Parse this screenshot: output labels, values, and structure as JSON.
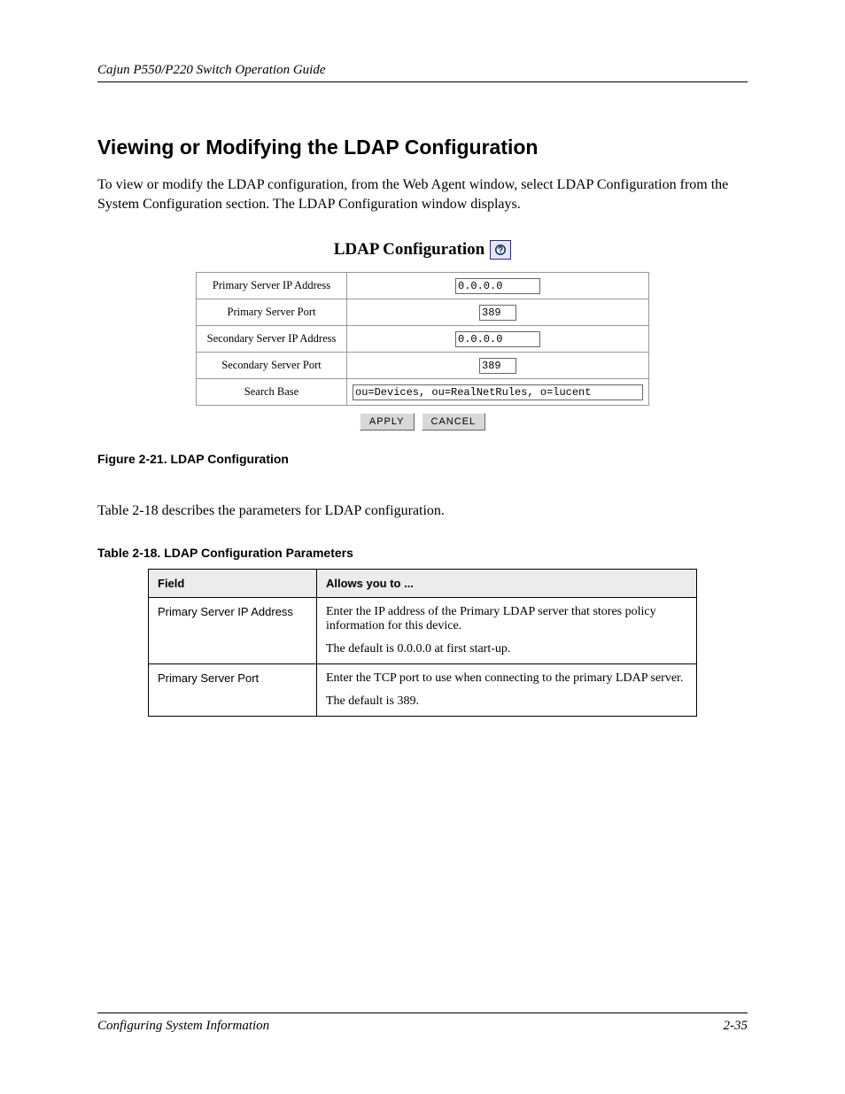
{
  "header": {
    "left": "Cajun P550/P220 Switch Operation Guide",
    "right": ""
  },
  "section_heading": "Viewing or Modifying the LDAP Configuration",
  "intro_text": "To view or modify the LDAP configuration, from the Web Agent window, select LDAP Configuration from the System Configuration section. The LDAP Configuration window displays.",
  "figure": {
    "title": "LDAP Configuration",
    "help_icon_name": "help-icon",
    "rows": [
      {
        "label": "Primary Server IP Address",
        "value": "0.0.0.0",
        "kind": "short"
      },
      {
        "label": "Primary Server Port",
        "value": "389",
        "kind": "tiny"
      },
      {
        "label": "Secondary Server IP Address",
        "value": "0.0.0.0",
        "kind": "short"
      },
      {
        "label": "Secondary Server Port",
        "value": "389",
        "kind": "tiny"
      },
      {
        "label": "Search Base",
        "value": "ou=Devices, ou=RealNetRules, o=lucent",
        "kind": "long"
      }
    ],
    "buttons": {
      "apply": "APPLY",
      "cancel": "CANCEL"
    }
  },
  "figure_caption": "Figure 2-21.  LDAP Configuration",
  "after_figure_text": "Table 2-18 describes the parameters for LDAP configuration.",
  "table_caption": "Table 2-18.  LDAP Configuration Parameters",
  "param_table": {
    "headers": {
      "field": "Field",
      "desc": "Allows you to ..."
    },
    "rows": [
      {
        "field": "Primary Server IP Address",
        "desc": [
          "Enter the IP address of the Primary LDAP server that stores policy information for this device.",
          "The default is 0.0.0.0 at first start-up."
        ]
      },
      {
        "field": "Primary Server Port",
        "desc": [
          "Enter the TCP port to use when connecting to the primary LDAP server.",
          "The default is 389."
        ]
      }
    ]
  },
  "footer": {
    "left": "Configuring System Information",
    "right": "2-35"
  }
}
